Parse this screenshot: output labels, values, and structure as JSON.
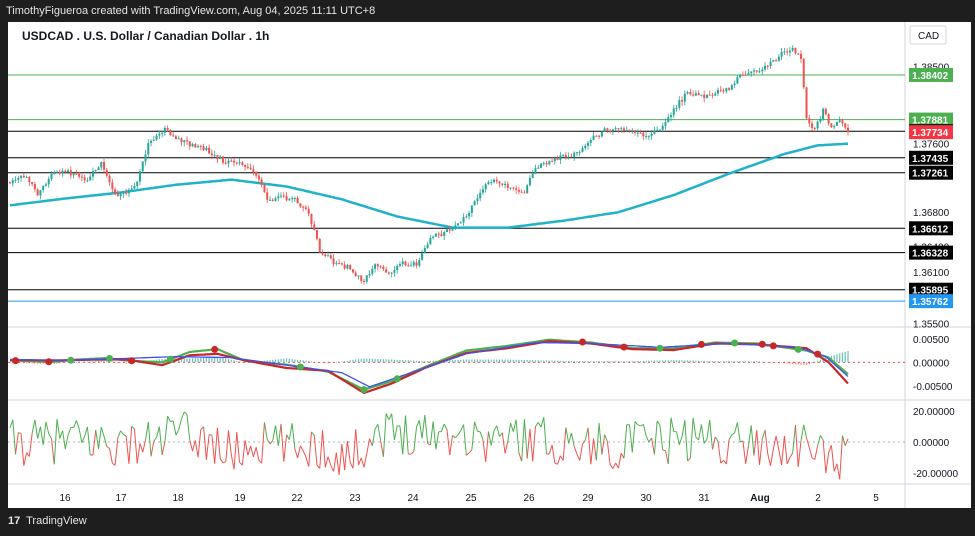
{
  "header": {
    "credit": "TimothyFigueroa created with TradingView.com, Aug 04, 2025 11:11 UTC+8"
  },
  "footer": {
    "brand": "TradingView",
    "logo_glyph": "17"
  },
  "chart": {
    "title": "USDCAD . U.S. Dollar / Canadian Dollar . 1h",
    "currency": "CAD"
  },
  "chart_data": [
    {
      "type": "line",
      "title": "USDCAD . U.S. Dollar / Canadian Dollar . 1h",
      "currency": "CAD",
      "ylim": [
        1.3546,
        1.3902
      ],
      "y_ticks": [
        "1.38500",
        "1.37600",
        "1.36800",
        "1.36400",
        "1.36100",
        "1.35500"
      ],
      "x_ticks": [
        "16",
        "17",
        "18",
        "19",
        "22",
        "23",
        "24",
        "25",
        "26",
        "29",
        "30",
        "31",
        "Aug",
        "2",
        "5"
      ],
      "levels": [
        {
          "value": 1.38402,
          "label": "1.38402",
          "line_color": "#4caf50",
          "tag_color": "#4caf50"
        },
        {
          "value": 1.37881,
          "label": "1.37881",
          "line_color": "#4caf50",
          "tag_color": "#4caf50"
        },
        {
          "value": 1.37745,
          "label": "1.37745",
          "line_color": "#000000",
          "tag_color": "#000000"
        },
        {
          "value": 1.37734,
          "label": "1.37734",
          "line_color": "",
          "tag_color": "#f23645"
        },
        {
          "value": 1.37435,
          "label": "1.37435",
          "line_color": "#000000",
          "tag_color": "#000000"
        },
        {
          "value": 1.37261,
          "label": "1.37261",
          "line_color": "#000000",
          "tag_color": "#000000"
        },
        {
          "value": 1.36612,
          "label": "1.36612",
          "line_color": "#000000",
          "tag_color": "#000000"
        },
        {
          "value": 1.36328,
          "label": "1.36328",
          "line_color": "#000000",
          "tag_color": "#000000"
        },
        {
          "value": 1.35895,
          "label": "1.35895",
          "line_color": "#000000",
          "tag_color": "#000000"
        },
        {
          "value": 1.35762,
          "label": "1.35762",
          "line_color": "#2196f3",
          "tag_color": "#2196f3"
        }
      ],
      "price_path": [
        [
          0,
          1.3715
        ],
        [
          6,
          1.3722
        ],
        [
          10,
          1.37
        ],
        [
          16,
          1.3728
        ],
        [
          24,
          1.3725
        ],
        [
          28,
          1.3718
        ],
        [
          33,
          1.3738
        ],
        [
          38,
          1.37
        ],
        [
          45,
          1.3708
        ],
        [
          50,
          1.3758
        ],
        [
          56,
          1.3778
        ],
        [
          60,
          1.3765
        ],
        [
          66,
          1.3758
        ],
        [
          70,
          1.3755
        ],
        [
          77,
          1.374
        ],
        [
          82,
          1.3738
        ],
        [
          88,
          1.373
        ],
        [
          93,
          1.3695
        ],
        [
          98,
          1.3698
        ],
        [
          103,
          1.3695
        ],
        [
          108,
          1.368
        ],
        [
          112,
          1.3635
        ],
        [
          118,
          1.362
        ],
        [
          123,
          1.3615
        ],
        [
          128,
          1.3598
        ],
        [
          132,
          1.362
        ],
        [
          137,
          1.361
        ],
        [
          142,
          1.362
        ],
        [
          147,
          1.362
        ],
        [
          152,
          1.365
        ],
        [
          157,
          1.3655
        ],
        [
          161,
          1.3665
        ],
        [
          166,
          1.368
        ],
        [
          170,
          1.3705
        ],
        [
          175,
          1.3718
        ],
        [
          180,
          1.371
        ],
        [
          186,
          1.3705
        ],
        [
          190,
          1.373
        ],
        [
          195,
          1.374
        ],
        [
          200,
          1.3745
        ],
        [
          205,
          1.3748
        ],
        [
          210,
          1.3765
        ],
        [
          215,
          1.3775
        ],
        [
          220,
          1.3778
        ],
        [
          226,
          1.3772
        ],
        [
          232,
          1.377
        ],
        [
          236,
          1.378
        ],
        [
          240,
          1.38
        ],
        [
          245,
          1.382
        ],
        [
          250,
          1.3815
        ],
        [
          255,
          1.382
        ],
        [
          260,
          1.3825
        ],
        [
          264,
          1.384
        ],
        [
          269,
          1.3845
        ],
        [
          274,
          1.385
        ],
        [
          279,
          1.3865
        ],
        [
          283,
          1.387
        ],
        [
          286,
          1.386
        ],
        [
          288,
          1.379
        ],
        [
          291,
          1.3775
        ],
        [
          294,
          1.38
        ],
        [
          297,
          1.378
        ],
        [
          300,
          1.3785
        ],
        [
          303,
          1.3773
        ]
      ],
      "series": [
        {
          "name": "",
          "color": "#20b2c8",
          "points": [
            [
              0,
              1.3688
            ],
            [
              20,
              1.3696
            ],
            [
              40,
              1.3703
            ],
            [
              60,
              1.3712
            ],
            [
              80,
              1.3718
            ],
            [
              100,
              1.371
            ],
            [
              120,
              1.3695
            ],
            [
              140,
              1.3675
            ],
            [
              160,
              1.3662
            ],
            [
              180,
              1.3662
            ],
            [
              200,
              1.367
            ],
            [
              220,
              1.368
            ],
            [
              240,
              1.37
            ],
            [
              260,
              1.3725
            ],
            [
              280,
              1.3748
            ],
            [
              292,
              1.3758
            ],
            [
              303,
              1.376
            ]
          ]
        }
      ]
    },
    {
      "type": "line",
      "ylim": [
        -0.008,
        0.0075
      ],
      "y_ticks": [
        "0.00500",
        "0.00000",
        "-0.00500"
      ],
      "series": [
        {
          "name": "",
          "color": "#4caf50",
          "points": [
            [
              0,
              0.0004
            ],
            [
              15,
              0.0001
            ],
            [
              25,
              0.0006
            ],
            [
              35,
              0.0009
            ],
            [
              42,
              0.0004
            ],
            [
              55,
              0.0
            ],
            [
              65,
              0.0022
            ],
            [
              75,
              0.0028
            ],
            [
              85,
              0.0003
            ],
            [
              100,
              -0.0005
            ],
            [
              115,
              -0.002
            ],
            [
              128,
              -0.0058
            ],
            [
              138,
              -0.004
            ],
            [
              150,
              -0.001
            ],
            [
              165,
              0.0025
            ],
            [
              180,
              0.0035
            ],
            [
              195,
              0.0048
            ],
            [
              210,
              0.0042
            ],
            [
              225,
              0.003
            ],
            [
              240,
              0.003
            ],
            [
              255,
              0.0042
            ],
            [
              270,
              0.004
            ],
            [
              288,
              0.0025
            ],
            [
              296,
              0.001
            ],
            [
              303,
              -0.0025
            ]
          ]
        },
        {
          "name": "",
          "color": "#c62828",
          "points": [
            [
              0,
              0.0005
            ],
            [
              15,
              0.0004
            ],
            [
              25,
              0.0005
            ],
            [
              35,
              0.0006
            ],
            [
              42,
              0.0006
            ],
            [
              55,
              -0.0006
            ],
            [
              65,
              0.0015
            ],
            [
              75,
              0.0018
            ],
            [
              85,
              0.0004
            ],
            [
              100,
              -0.0012
            ],
            [
              115,
              -0.0018
            ],
            [
              128,
              -0.0065
            ],
            [
              138,
              -0.0045
            ],
            [
              150,
              -0.0012
            ],
            [
              165,
              0.002
            ],
            [
              180,
              0.003
            ],
            [
              195,
              0.0045
            ],
            [
              210,
              0.004
            ],
            [
              225,
              0.0028
            ],
            [
              240,
              0.0026
            ],
            [
              255,
              0.004
            ],
            [
              270,
              0.0038
            ],
            [
              288,
              0.003
            ],
            [
              296,
              0.0
            ],
            [
              303,
              -0.0045
            ]
          ]
        },
        {
          "name": "",
          "color": "#3f51f5",
          "points": [
            [
              0,
              0.0006
            ],
            [
              20,
              0.0004
            ],
            [
              40,
              0.0008
            ],
            [
              60,
              0.0012
            ],
            [
              80,
              0.001
            ],
            [
              100,
              -0.0006
            ],
            [
              120,
              -0.0022
            ],
            [
              130,
              -0.0052
            ],
            [
              145,
              -0.0022
            ],
            [
              165,
              0.0018
            ],
            [
              190,
              0.0042
            ],
            [
              210,
              0.004
            ],
            [
              235,
              0.0032
            ],
            [
              260,
              0.004
            ],
            [
              285,
              0.0032
            ],
            [
              295,
              0.0012
            ],
            [
              303,
              -0.003
            ]
          ]
        }
      ]
    },
    {
      "type": "line",
      "ylim": [
        -27,
        27
      ],
      "y_ticks": [
        "20.00000",
        "0.00000",
        "-20.00000"
      ]
    }
  ]
}
